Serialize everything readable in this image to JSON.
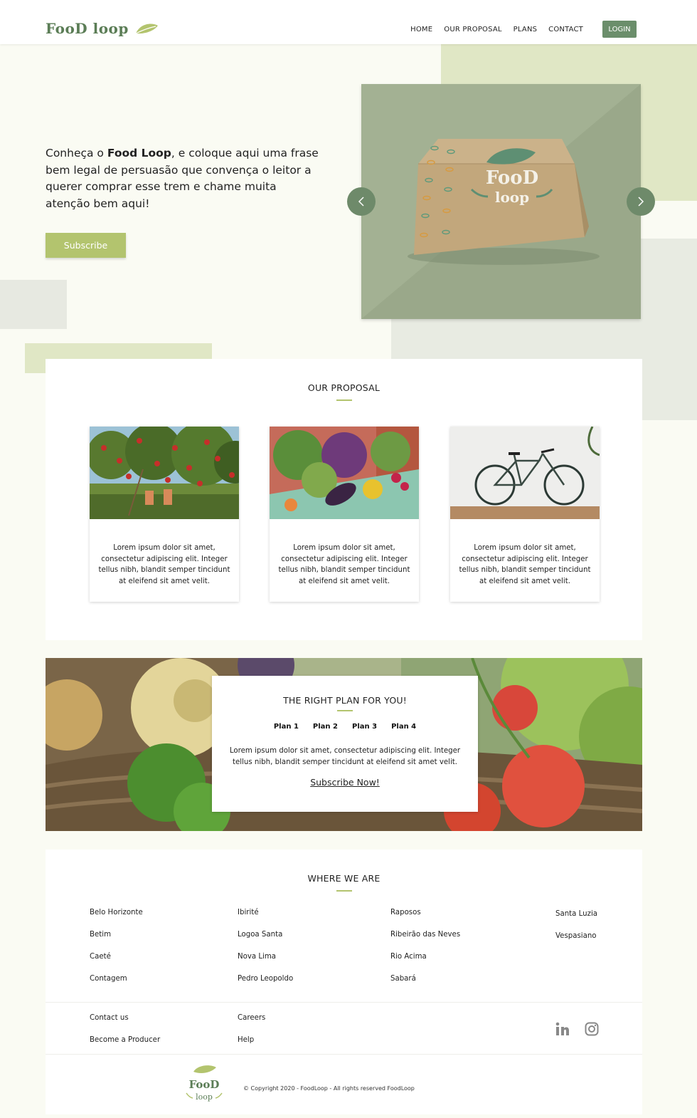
{
  "header": {
    "logo_text": "FooD loop",
    "nav": [
      "HOME",
      "OUR PROPOSAL",
      "PLANS",
      "CONTACT"
    ],
    "login": "LOGIN"
  },
  "hero": {
    "text_before": "Conheça o ",
    "text_bold": "Food Loop",
    "text_after": ", e coloque aqui uma frase bem legal de persuasão que convença o leitor a querer comprar esse trem e chame muita atenção bem aqui!",
    "subscribe": "Subscribe",
    "box_logo_top": "FooD",
    "box_logo_bottom": "loop"
  },
  "proposal": {
    "title": "OUR PROPOSAL",
    "cards": [
      {
        "image": "apple-orchard",
        "text": "Lorem ipsum dolor sit amet, consectetur adipiscing elit. Integer tellus nibh, blandit semper tincidunt at eleifend sit amet velit."
      },
      {
        "image": "vegetable-crate",
        "text": "Lorem ipsum dolor sit amet, consectetur adipiscing elit. Integer tellus nibh, blandit semper tincidunt at eleifend sit amet velit."
      },
      {
        "image": "bicycle",
        "text": "Lorem ipsum dolor sit amet, consectetur adipiscing elit. Integer tellus nibh, blandit semper tincidunt at eleifend sit amet velit."
      }
    ]
  },
  "plans": {
    "title": "THE RIGHT PLAN FOR YOU!",
    "tabs": [
      "Plan 1",
      "Plan 2",
      "Plan 3",
      "Plan 4"
    ],
    "text": "Lorem ipsum dolor sit amet, consectetur adipiscing elit. Integer tellus nibh, blandit semper tincidunt at eleifend sit amet velit.",
    "cta": "Subscribe Now!"
  },
  "where": {
    "title": "WHERE WE ARE",
    "columns": [
      [
        "Belo Horizonte",
        "Betim",
        "Caeté",
        "Contagem"
      ],
      [
        "Ibirité",
        "Logoa Santa",
        "Nova Lima",
        "Pedro Leopoldo"
      ],
      [
        "Raposos",
        "Ribeirão das Neves",
        "Rio Acima",
        "Sabará"
      ],
      [
        "Santa Luzia",
        "Vespasiano"
      ]
    ]
  },
  "footer": {
    "links": [
      "Contact us",
      "Become a Producer",
      "Careers",
      "Help"
    ],
    "social": [
      "linkedin-icon",
      "instagram-icon"
    ],
    "logo_top": "FooD",
    "logo_bottom": "loop",
    "copyright": "© Copyright 2020 - FoodLoop - All rights reserved FoodLoop"
  },
  "colors": {
    "accent_green": "#b3c46e",
    "dark_green": "#6b8e6b",
    "page_bg": "#fafbf3",
    "slider_bg": "#a3b193"
  }
}
